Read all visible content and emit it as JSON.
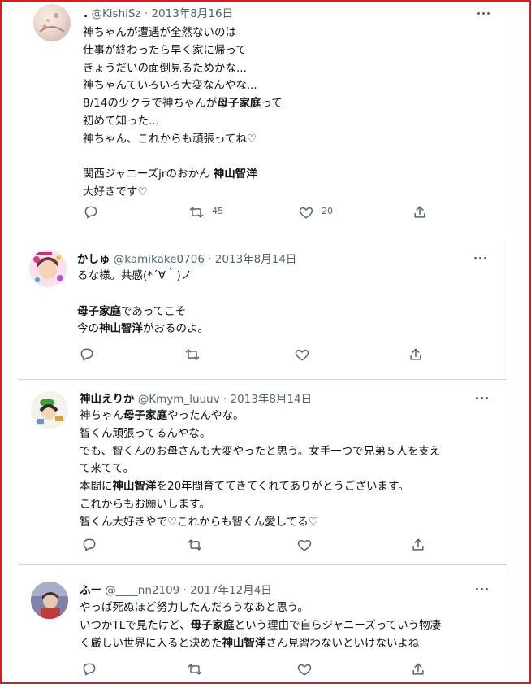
{
  "icons": {
    "more": "more-horizontal-icon",
    "reply": "reply-icon",
    "retweet": "retweet-icon",
    "like": "heart-icon",
    "share": "share-icon"
  },
  "tweets": [
    {
      "display_name": ".",
      "handle": "@KishiSz",
      "date": "2013年8月16日",
      "lines": [
        [
          "神ちゃんが遭遇が全然ないのは"
        ],
        [
          "仕事が終わったら早く家に帰って"
        ],
        [
          "きょうだいの面倒見るためかな..."
        ],
        [
          "神ちゃんていろいろ大変なんやな..."
        ],
        [
          "8/14の少クラで神ちゃんが",
          "母子家庭",
          "って"
        ],
        [
          "初めて知った..."
        ],
        [
          "神ちゃん、これからも頑張ってね♡"
        ],
        [
          ""
        ],
        [
          "関西ジャニーズjrのおかん ",
          "神山智洋"
        ],
        [
          "大好きです♡"
        ]
      ],
      "retweets": "45",
      "likes": "20"
    },
    {
      "display_name": "かしゅ",
      "handle": "@kamikake0706",
      "date": "2013年8月14日",
      "lines": [
        [
          "るな様。共感(*´∀｀)ノ"
        ],
        [
          ""
        ],
        [
          "",
          "母子家庭",
          "であってこそ"
        ],
        [
          "今の",
          "神山智洋",
          "がおるのよ。"
        ]
      ],
      "retweets": "",
      "likes": ""
    },
    {
      "display_name": "神山えりか",
      "handle": "@Kmym_luuuv",
      "date": "2013年8月14日",
      "lines": [
        [
          "神ちゃん",
          "母子家庭",
          "やったんやな。"
        ],
        [
          "智くん頑張ってるんやな。"
        ],
        [
          "でも、智くんのお母さんも大変やったと思う。女手一つで兄弟５人を支え"
        ],
        [
          "て来てて。"
        ],
        [
          "本間に",
          "神山智洋",
          "を20年間育ててきてくれてありがとうございます。"
        ],
        [
          "これからもお願いします。"
        ],
        [
          "智くん大好きやで♡これからも智くん愛してる♡"
        ]
      ],
      "retweets": "",
      "likes": ""
    },
    {
      "display_name": "ふー",
      "handle": "@____nn2109",
      "date": "2017年12月4日",
      "lines": [
        [
          "やっぱ死ぬほど努力したんだろうなあと思う。"
        ],
        [
          "いつかTLで見たけど、",
          "母子家庭",
          "という理由で自らジャニーズっていう物凄"
        ],
        [
          "く厳しい世界に入ると決めた",
          "神山智洋",
          "さん見習わないといけないよね"
        ]
      ],
      "retweets": "",
      "likes": ""
    }
  ]
}
